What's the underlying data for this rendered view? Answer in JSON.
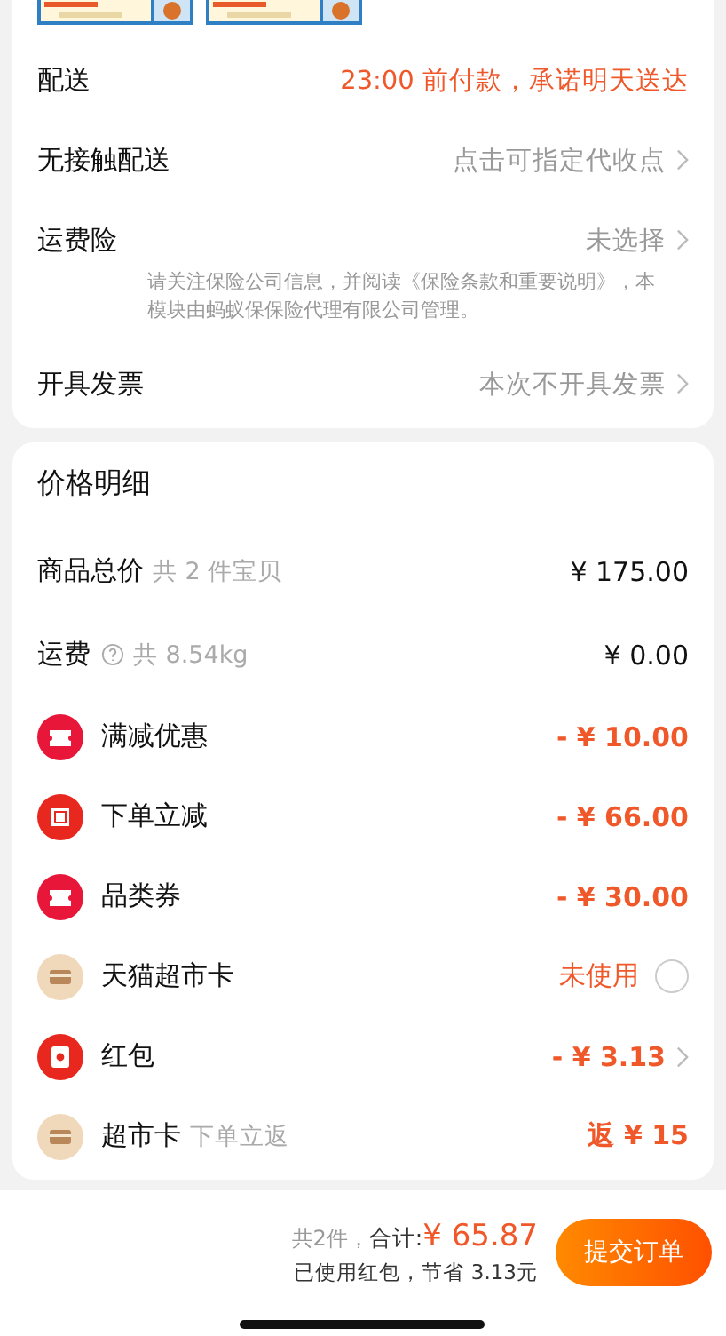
{
  "delivery_rows": [
    {
      "label": "配送",
      "value": "23:00 前付款，承诺明天送达",
      "accent": true,
      "chevron": false
    },
    {
      "label": "无接触配送",
      "value": "点击可指定代收点",
      "accent": false,
      "chevron": true
    },
    {
      "label": "运费险",
      "value": "未选择",
      "accent": false,
      "chevron": true,
      "note": "请关注保险公司信息，并阅读《保险条款和重要说明》，本模块由蚂蚁保保险代理有限公司管理。"
    },
    {
      "label": "开具发票",
      "value": "本次不开具发票",
      "accent": false,
      "chevron": true
    }
  ],
  "price_detail": {
    "title": "价格明细",
    "rows": [
      {
        "kind": "plain",
        "label": "商品总价",
        "note": "共 2 件宝贝",
        "value": "¥ 175.00",
        "help": false
      },
      {
        "kind": "plain",
        "label": "运费",
        "note": "共 8.54kg",
        "value": "¥ 0.00",
        "help": true
      },
      {
        "kind": "discount",
        "label": "满减优惠",
        "value": "- ¥ 10.00",
        "color": "#e8173a"
      },
      {
        "kind": "discount",
        "label": "下单立减",
        "value": "- ¥ 66.00",
        "color": "#e8281e"
      },
      {
        "kind": "discount",
        "label": "品类券",
        "value": "- ¥ 30.00",
        "color": "#e8173a"
      },
      {
        "kind": "toggle",
        "label": "天猫超市卡",
        "value": "未使用",
        "checked": false,
        "color": "#f0d9bb"
      },
      {
        "kind": "link",
        "label": "红包",
        "value": "- ¥ 3.13",
        "color": "#e8281e"
      },
      {
        "kind": "rebate",
        "label": "超市卡",
        "note": "下单立返",
        "value": "返 ¥ 15",
        "color": "#f0d9bb"
      }
    ]
  },
  "footer": {
    "count": "共2件，",
    "total_label": "合计:",
    "total": "¥ 65.87",
    "savings": "已使用红包，节省 3.13元",
    "submit": "提交订单"
  }
}
